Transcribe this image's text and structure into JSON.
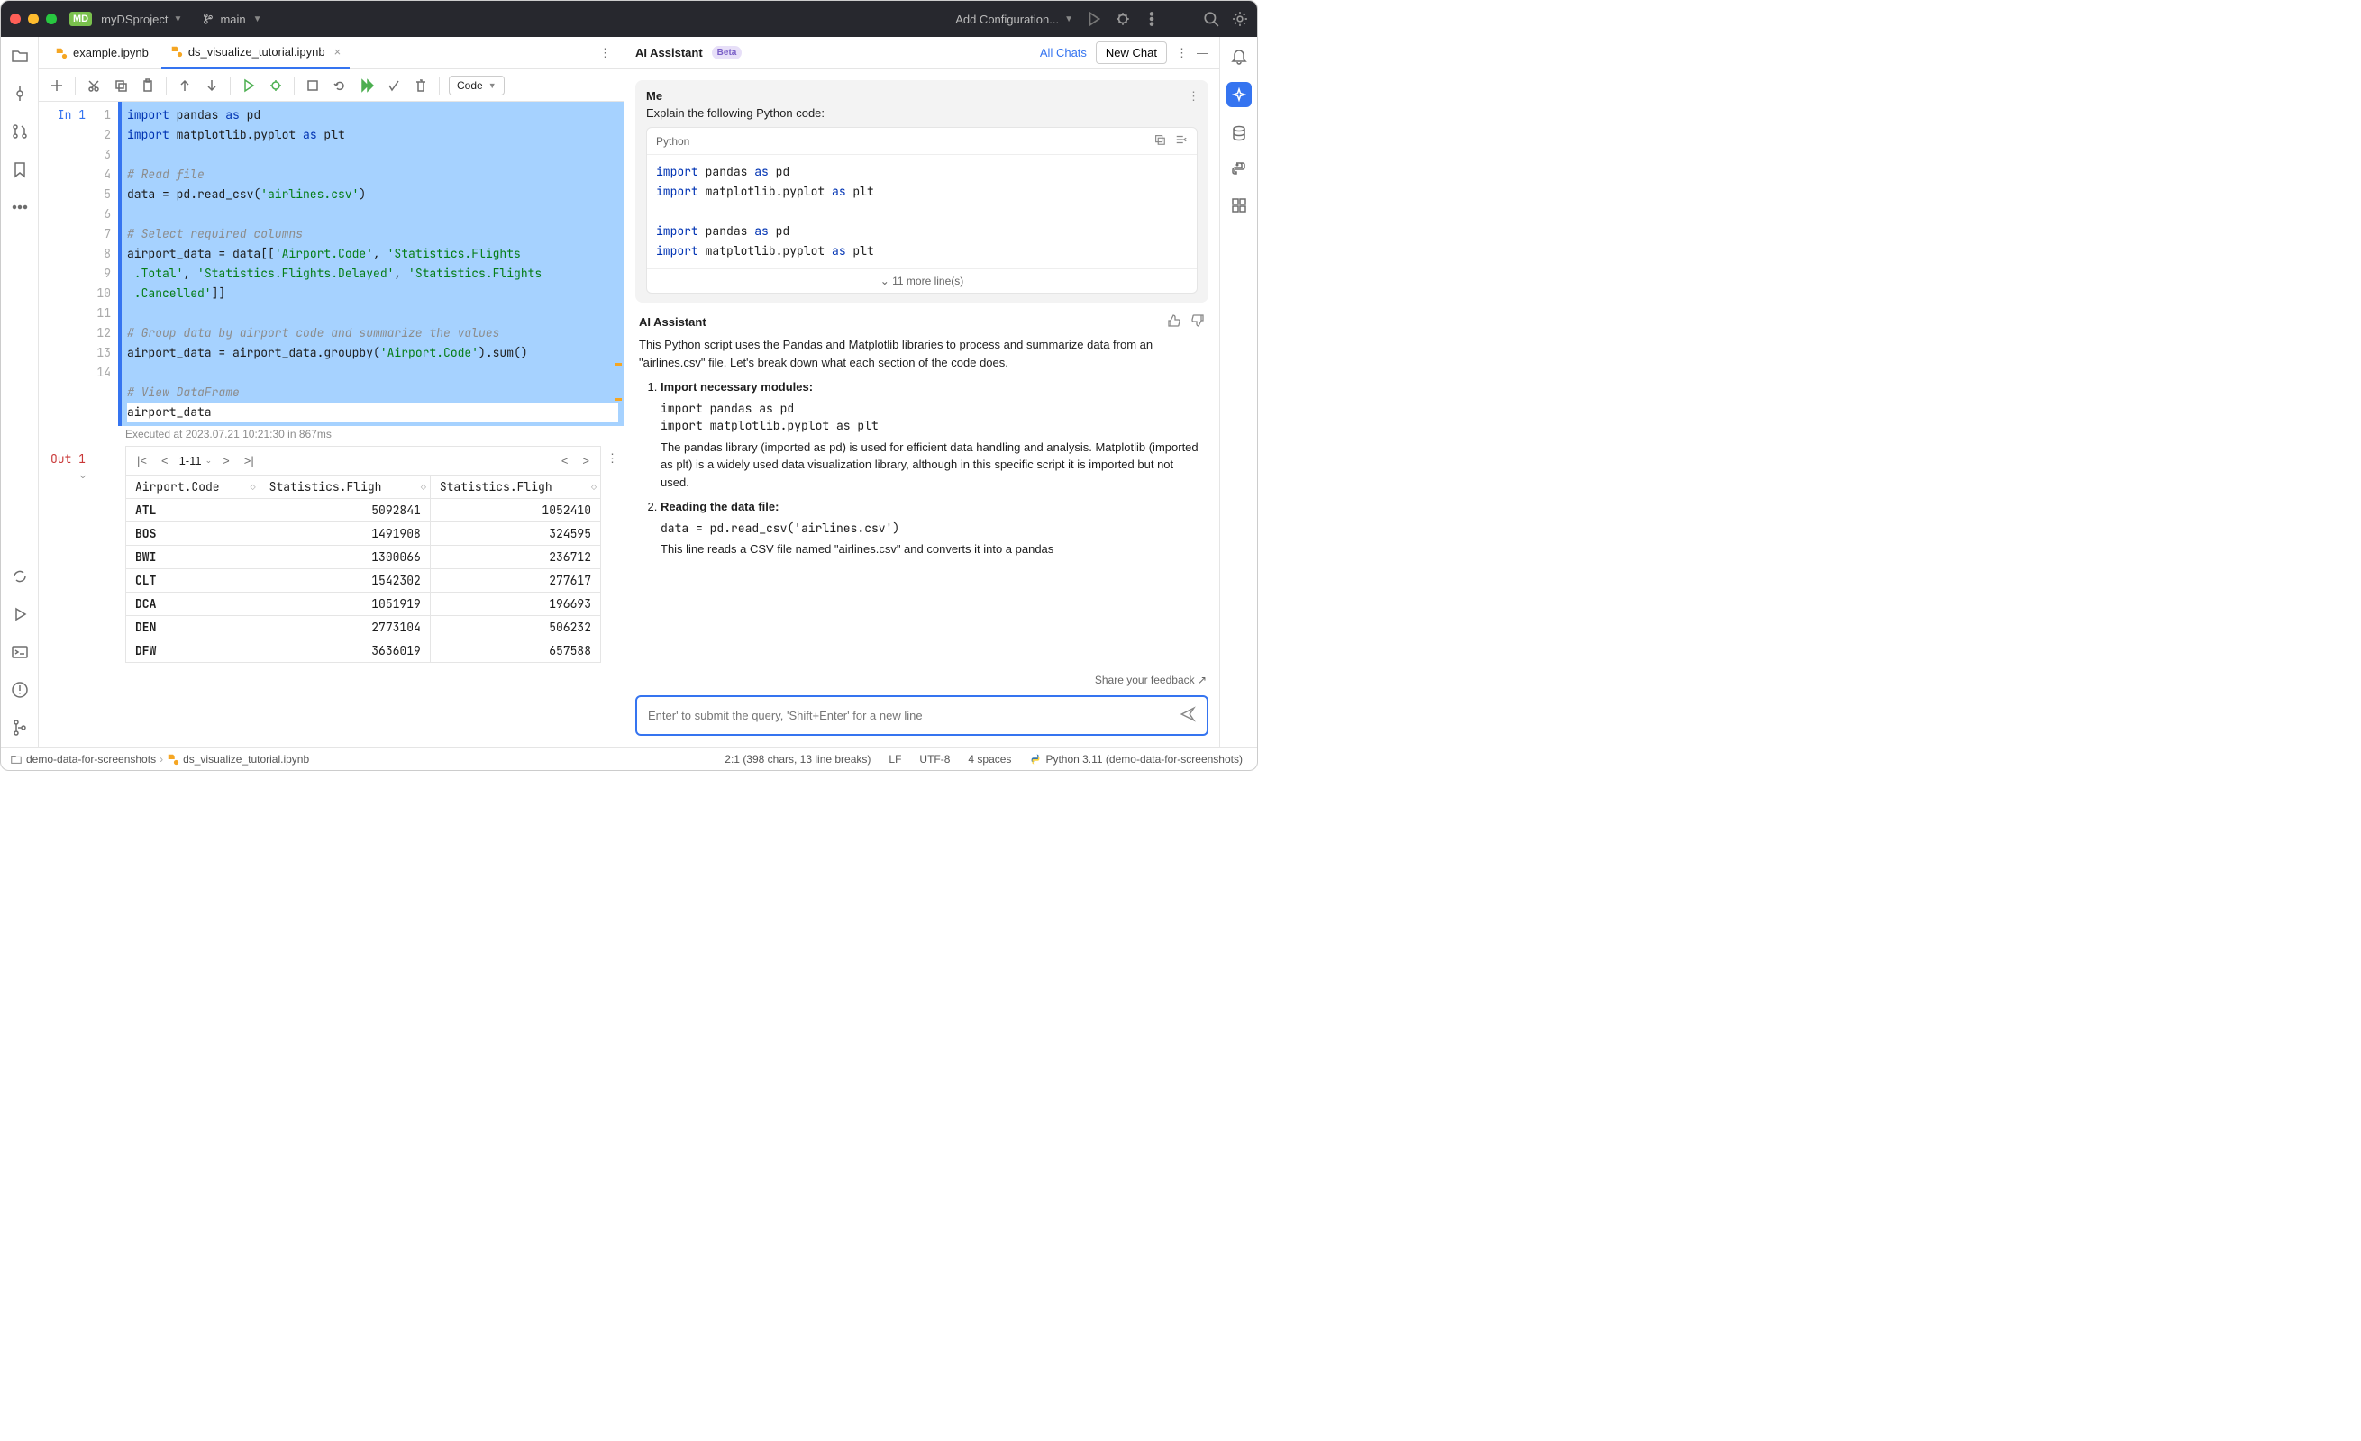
{
  "titlebar": {
    "project_badge": "MD",
    "project_name": "myDSproject",
    "branch": "main",
    "run_config": "Add Configuration..."
  },
  "tabs": {
    "t1": "example.ipynb",
    "t2": "ds_visualize_tutorial.ipynb"
  },
  "toolbar": {
    "cell_type": "Code"
  },
  "cell": {
    "in_label": "In 1",
    "exec_info": "Executed at 2023.07.21 10:21:30 in 867ms",
    "out_label": "Out 1"
  },
  "pager": {
    "range": "1-11"
  },
  "table": {
    "h1": "Airport.Code",
    "h2": "Statistics.Fligh",
    "h3": "Statistics.Fligh",
    "rows": [
      {
        "c": "ATL",
        "v1": "5092841",
        "v2": "1052410"
      },
      {
        "c": "BOS",
        "v1": "1491908",
        "v2": "324595"
      },
      {
        "c": "BWI",
        "v1": "1300066",
        "v2": "236712"
      },
      {
        "c": "CLT",
        "v1": "1542302",
        "v2": "277617"
      },
      {
        "c": "DCA",
        "v1": "1051919",
        "v2": "196693"
      },
      {
        "c": "DEN",
        "v1": "2773104",
        "v2": "506232"
      },
      {
        "c": "DFW",
        "v1": "3636019",
        "v2": "657588"
      }
    ]
  },
  "ai": {
    "title": "AI Assistant",
    "beta": "Beta",
    "all_chats": "All Chats",
    "new_chat": "New Chat",
    "me_label": "Me",
    "prompt": "Explain the following Python code:",
    "code_lang": "Python",
    "more_lines": "11 more line(s)",
    "assistant_label": "AI Assistant",
    "assistant_intro": "This Python script uses the Pandas and Matplotlib libraries to process and summarize data from an \"airlines.csv\" file. Let's break down what each section of the code does.",
    "step1_title": "Import necessary modules:",
    "step1_code": "import pandas as pd\nimport matplotlib.pyplot as plt",
    "step1_text": "The pandas library (imported as pd) is used for efficient data handling and analysis. Matplotlib (imported as plt) is a widely used data visualization library, although in this specific script it is imported but not used.",
    "step2_title": "Reading the data file:",
    "step2_code": "data = pd.read_csv('airlines.csv')",
    "step2_text": "This line reads a CSV file named \"airlines.csv\" and converts it into a pandas",
    "feedback": "Share your feedback ↗",
    "placeholder": "Enter' to submit the query, 'Shift+Enter' for a new line"
  },
  "status": {
    "crumb1": "demo-data-for-screenshots",
    "crumb2": "ds_visualize_tutorial.ipynb",
    "pos": "2:1 (398 chars, 13 line breaks)",
    "eol": "LF",
    "enc": "UTF-8",
    "indent": "4 spaces",
    "python": "Python 3.11 (demo-data-for-screenshots)"
  }
}
